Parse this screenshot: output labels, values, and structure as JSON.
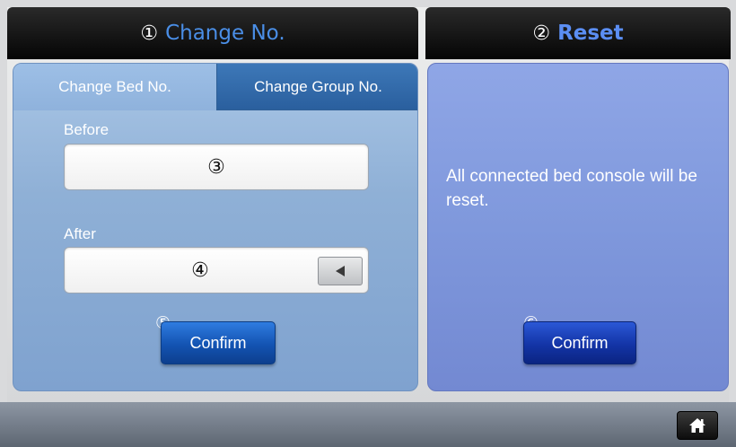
{
  "change_panel": {
    "header_number": "①",
    "header_title": "Change No.",
    "tabs": [
      {
        "label": "Change Bed No.",
        "active": true
      },
      {
        "label": "Change Group No.",
        "active": false
      }
    ],
    "before_label": "Before",
    "before_value": "③",
    "after_label": "After",
    "after_value": "④",
    "confirm_marker": "⑤",
    "confirm_label": "Confirm"
  },
  "reset_panel": {
    "header_number": "②",
    "header_title": "Reset",
    "message": "All connected bed console will be reset.",
    "confirm_marker": "⑥",
    "confirm_label": "Confirm"
  },
  "footer": {
    "home_icon": "home-icon"
  },
  "colors": {
    "header_bg": "#0a0a0a",
    "left_title": "#4a8ee6",
    "right_title": "#5b8ef3",
    "left_panel": "#8fb0d6",
    "right_panel": "#7f98dc",
    "button": "#1353b2"
  }
}
